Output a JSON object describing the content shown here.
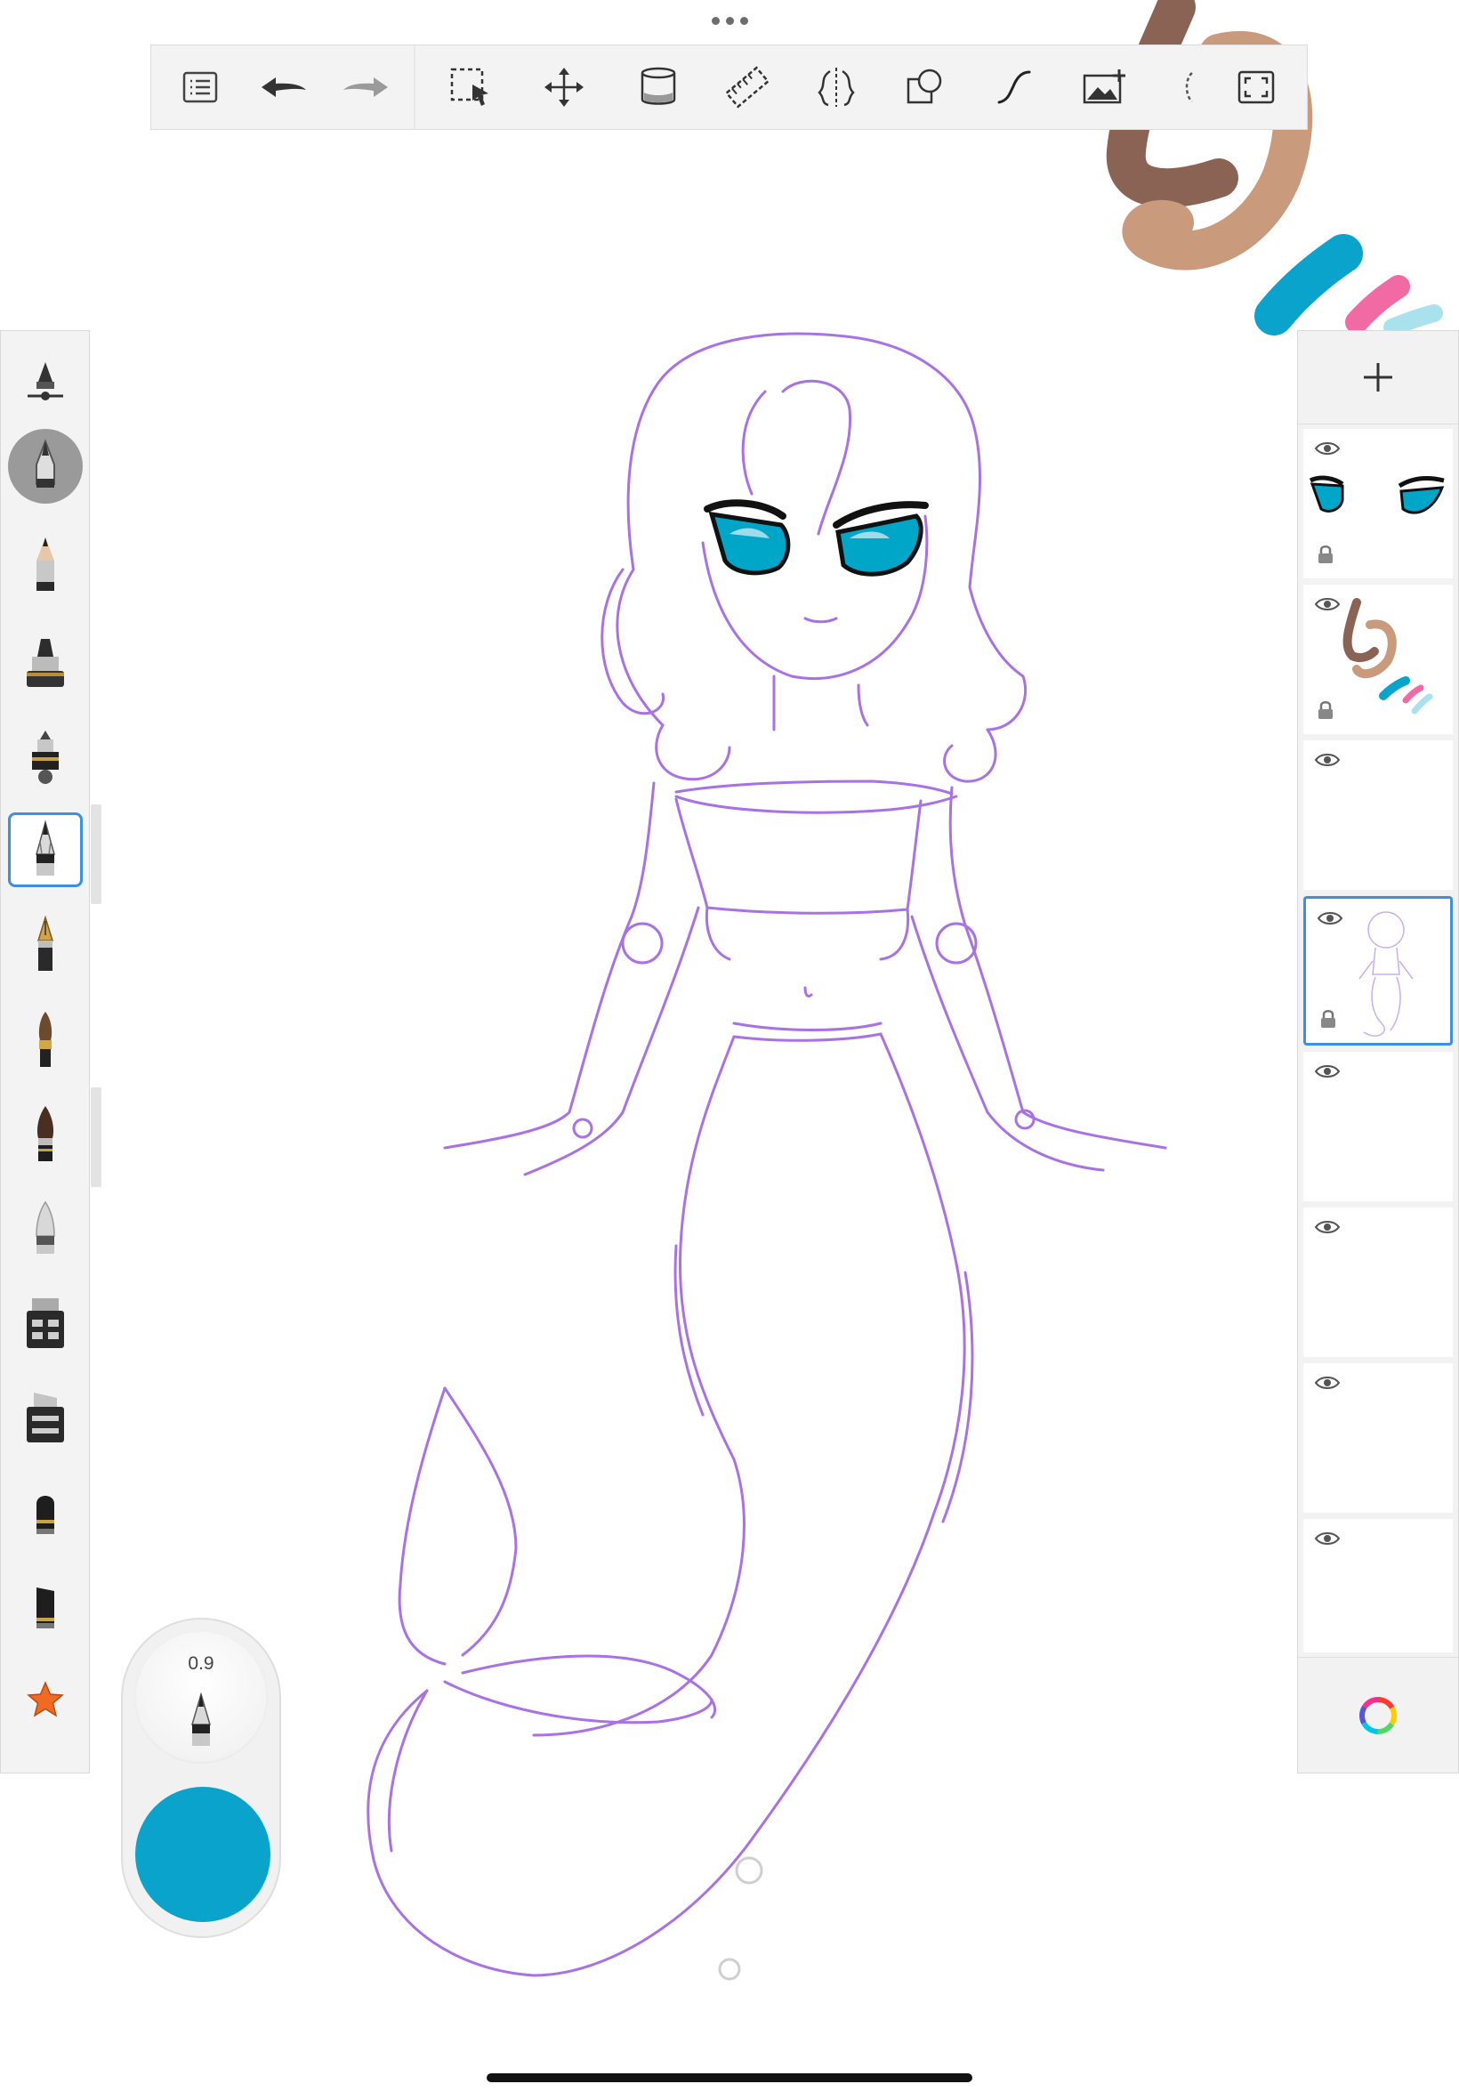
{
  "app": "Sketchbook",
  "toolbar": {
    "tools": [
      "menu",
      "undo",
      "redo",
      "selection",
      "transform",
      "fill",
      "ruler",
      "symmetry",
      "shapes",
      "steady-stroke",
      "add-image",
      "fullscreen"
    ]
  },
  "brush_palette": {
    "brushes": [
      "brush-size-slider",
      "brush-properties",
      "pencil",
      "marker",
      "airbrush",
      "ballpoint-pen",
      "fountain-pen",
      "paintbrush",
      "ink-brush",
      "soft-eraser",
      "chisel-marker",
      "flat-marker",
      "felt-tip",
      "calligraphy",
      "favorites"
    ],
    "selected": "ballpoint-pen"
  },
  "puck": {
    "size_value": "0.9",
    "color": "#0aa3cc"
  },
  "layers": {
    "items": [
      {
        "name": "eyes",
        "visible": true,
        "locked": true
      },
      {
        "name": "colour-swatches",
        "visible": true,
        "locked": true
      },
      {
        "name": "empty",
        "visible": true,
        "locked": false
      },
      {
        "name": "mermaid-sketch",
        "visible": true,
        "locked": true,
        "active": true
      },
      {
        "name": "empty",
        "visible": true,
        "locked": false
      },
      {
        "name": "empty",
        "visible": true,
        "locked": false
      },
      {
        "name": "empty",
        "visible": true,
        "locked": false
      },
      {
        "name": "empty",
        "visible": true,
        "locked": false
      }
    ]
  },
  "colors": {
    "accent": "#3d8ee6",
    "sketch_line": "#a872e6",
    "eye_teal": "#00a6c8",
    "swatch_brown": "#8a6355",
    "swatch_tan": "#c99a7b",
    "swatch_blue": "#0aa3cc",
    "swatch_pink": "#f26aa3",
    "swatch_light_blue": "#a9e2ec"
  }
}
